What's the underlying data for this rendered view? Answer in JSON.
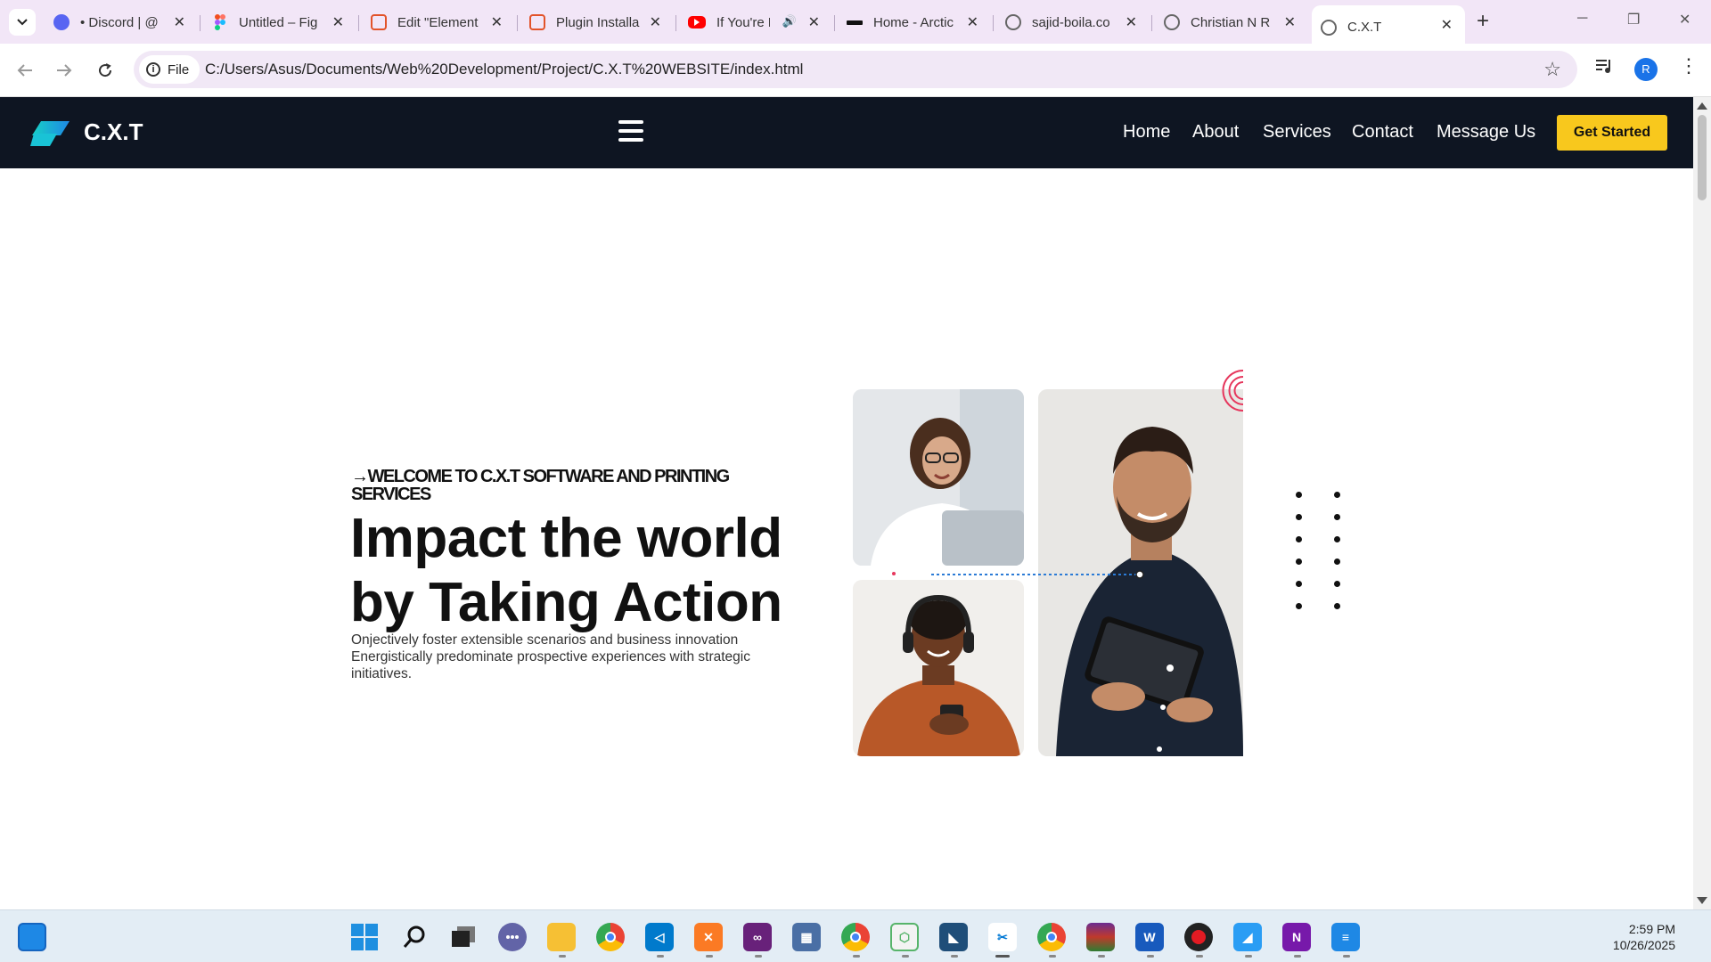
{
  "browser": {
    "tabs": [
      {
        "title": "• Discord | @",
        "icon": "discord-icon",
        "color": "#5865f2"
      },
      {
        "title": "Untitled – Fig",
        "icon": "figma-icon",
        "color": "#f24e1e"
      },
      {
        "title": "Edit \"Element",
        "icon": "elementor-icon",
        "color": "#e2532a"
      },
      {
        "title": "Plugin Installa",
        "icon": "xampp-icon",
        "color": "#e2532a"
      },
      {
        "title": "If You're N",
        "icon": "youtube-icon",
        "color": "#ff0000"
      },
      {
        "title": "Home - Arctic",
        "icon": "arctic-icon",
        "color": "#111111"
      },
      {
        "title": "sajid-boila.co",
        "icon": "globe-icon",
        "color": "#555555"
      },
      {
        "title": "Christian N R",
        "icon": "globe-icon",
        "color": "#555555"
      },
      {
        "title": "C.X.T",
        "icon": "globe-icon",
        "color": "#555555"
      }
    ],
    "chip_label": "File",
    "url": "C:/Users/Asus/Documents/Web%20Development/Project/C.X.T%20WEBSITE/index.html",
    "profile_initial": "R"
  },
  "site": {
    "brand": "C.X.T",
    "nav": [
      "Home",
      "About",
      "Services",
      "Contact",
      "Message Us"
    ],
    "cta": "Get Started",
    "accent": "#f8c81d",
    "nav_bg": "#0e1522"
  },
  "hero": {
    "kicker": "→WELCOME TO C.X.T SOFTWARE AND PRINTING SERVICES",
    "title_line1": "Impact the world",
    "title_line2": "by Taking Action",
    "description": "Onjectively foster extensible scenarios and business innovation Energistically predominate prospective experiences with strategic initiatives."
  },
  "taskbar": {
    "apps": [
      "start-icon",
      "search-icon",
      "task-view-icon",
      "teams-chat-icon",
      "file-explorer-icon",
      "chrome-icon",
      "vscode-icon",
      "xampp-icon",
      "visual-studio-icon",
      "calculator-icon",
      "chrome-profile-icon",
      "app-cube-icon",
      "mysql-workbench-icon",
      "snipping-tool-icon",
      "chrome-alt-icon",
      "winrar-icon",
      "word-icon",
      "recorder-icon",
      "photos-icon",
      "onenote-icon",
      "notepad-icon"
    ],
    "time": "2:59 PM",
    "date": "10/26/2025"
  }
}
